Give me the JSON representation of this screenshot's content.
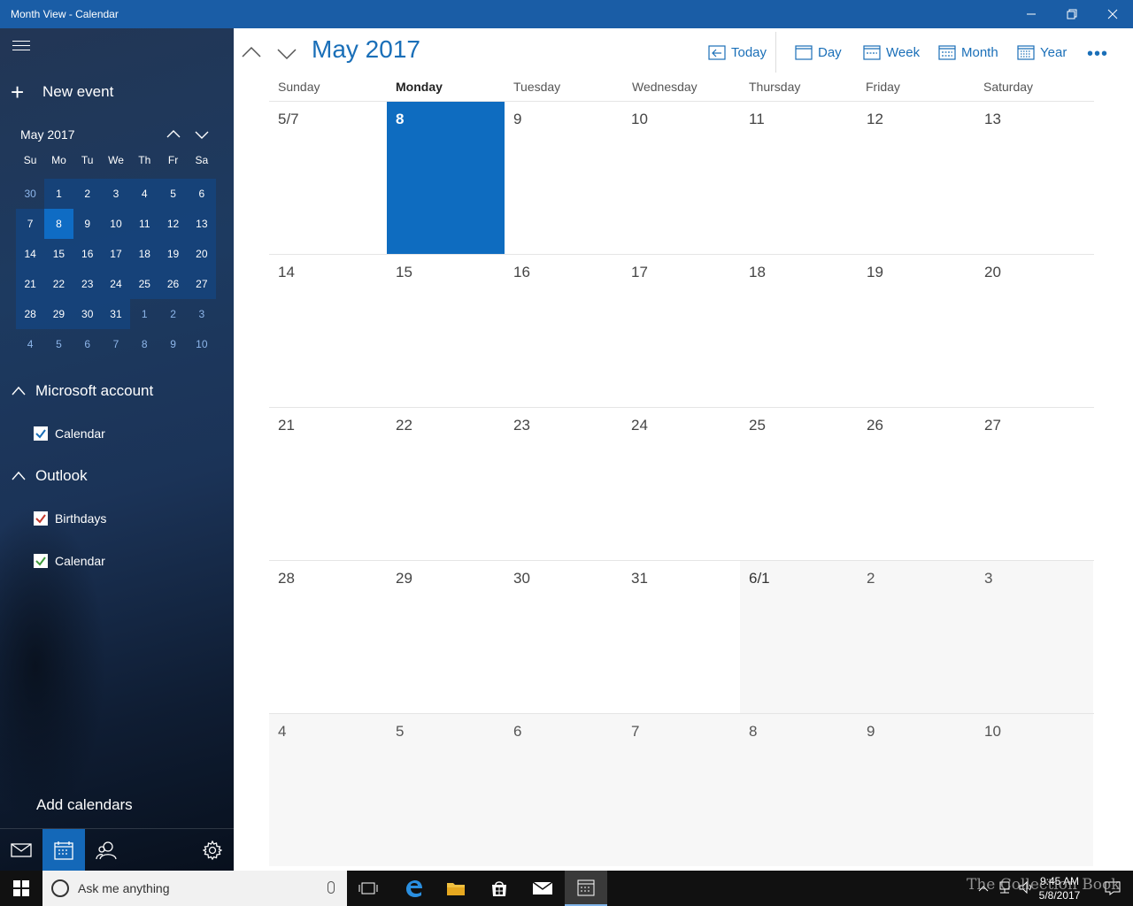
{
  "window": {
    "title": "Month View - Calendar"
  },
  "sidebar": {
    "new_event": "New event",
    "mini_month": "May 2017",
    "dow": [
      "Su",
      "Mo",
      "Tu",
      "We",
      "Th",
      "Fr",
      "Sa"
    ],
    "mini_weeks": [
      [
        "30",
        "1",
        "2",
        "3",
        "4",
        "5",
        "6"
      ],
      [
        "7",
        "8",
        "9",
        "10",
        "11",
        "12",
        "13"
      ],
      [
        "14",
        "15",
        "16",
        "17",
        "18",
        "19",
        "20"
      ],
      [
        "21",
        "22",
        "23",
        "24",
        "25",
        "26",
        "27"
      ],
      [
        "28",
        "29",
        "30",
        "31",
        "1",
        "2",
        "3"
      ],
      [
        "4",
        "5",
        "6",
        "7",
        "8",
        "9",
        "10"
      ]
    ],
    "accounts": [
      {
        "name": "Microsoft account",
        "calendars": [
          {
            "label": "Calendar",
            "color": "#1a6fb8"
          }
        ]
      },
      {
        "name": "Outlook",
        "calendars": [
          {
            "label": "Birthdays",
            "color": "#c4372b"
          },
          {
            "label": "Calendar",
            "color": "#3f9b3c"
          }
        ]
      }
    ],
    "add_calendars": "Add calendars"
  },
  "header": {
    "month_title": "May 2017",
    "today": "Today",
    "day": "Day",
    "week": "Week",
    "month": "Month",
    "year": "Year",
    "more": "•••"
  },
  "grid": {
    "dow": [
      "Sunday",
      "Monday",
      "Tuesday",
      "Wednesday",
      "Thursday",
      "Friday",
      "Saturday"
    ],
    "weeks": [
      [
        "5/7",
        "8",
        "9",
        "10",
        "11",
        "12",
        "13"
      ],
      [
        "14",
        "15",
        "16",
        "17",
        "18",
        "19",
        "20"
      ],
      [
        "21",
        "22",
        "23",
        "24",
        "25",
        "26",
        "27"
      ],
      [
        "28",
        "29",
        "30",
        "31",
        "6/1",
        "2",
        "3"
      ],
      [
        "4",
        "5",
        "6",
        "7",
        "8",
        "9",
        "10"
      ]
    ]
  },
  "taskbar": {
    "search_placeholder": "Ask me anything",
    "time": "9:45 AM",
    "date": "5/8/2017"
  },
  "watermark": "The Collection Book",
  "colors": {
    "accent": "#1a6fb8",
    "titlebar": "#1a5da6",
    "today_cell": "#0e6cc0"
  }
}
